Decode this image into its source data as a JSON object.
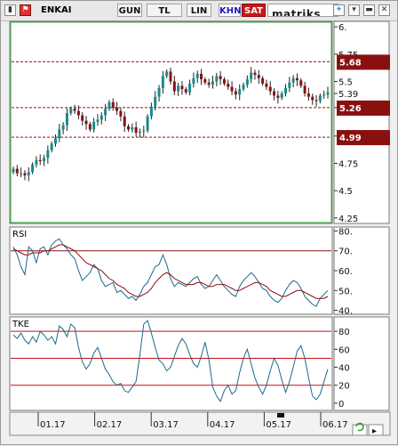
{
  "toolbar": {
    "symbol": "ENKAI",
    "buttons": [
      "GUN",
      "TL",
      "LIN",
      "KHN",
      "SAT"
    ],
    "brand": "matriks",
    "icons": [
      "bar-chart-icon",
      "flag-icon",
      "twitter-icon",
      "dropdown-icon",
      "minimize-icon",
      "close-icon"
    ]
  },
  "colors": {
    "up_candle": "#1a8a8a",
    "down_candle": "#8a1010",
    "wick": "#222222",
    "level_line": "#8a1010",
    "price_pill": "#8a1010",
    "rsi_line": "#1a6a8a",
    "rsi_signal": "#8a1010",
    "tke_line": "#1a6a8a",
    "hline": "#c81010",
    "panel_bg": "#ffffff"
  },
  "chart_data": [
    {
      "type": "candlestick",
      "title": "ENKAI",
      "ylim": [
        4.2,
        6.05
      ],
      "yticks": [
        "6.",
        "5.75",
        "5.5",
        "5.39",
        "5.26",
        "5",
        "4.75",
        "4.5",
        "4.25"
      ],
      "ytick_values": [
        6.0,
        5.75,
        5.5,
        5.39,
        5.26,
        5.0,
        4.75,
        4.5,
        4.25
      ],
      "levels": [
        {
          "label": "5.68",
          "value": 5.68
        },
        {
          "label": "5.26",
          "value": 5.26
        },
        {
          "label": "4.99",
          "value": 4.99
        }
      ],
      "x_labels": [
        "01.17",
        "02.17",
        "03.17",
        "04.17",
        "05.17",
        "06.17"
      ],
      "closes": [
        4.7,
        4.66,
        4.66,
        4.64,
        4.67,
        4.74,
        4.78,
        4.77,
        4.8,
        4.87,
        4.93,
        4.98,
        5.06,
        5.1,
        5.21,
        5.25,
        5.23,
        5.19,
        5.14,
        5.11,
        5.06,
        5.13,
        5.15,
        5.19,
        5.25,
        5.31,
        5.26,
        5.23,
        5.18,
        5.09,
        5.06,
        5.08,
        5.03,
        5.04,
        5.05,
        5.18,
        5.27,
        5.36,
        5.44,
        5.55,
        5.59,
        5.5,
        5.41,
        5.46,
        5.43,
        5.4,
        5.48,
        5.53,
        5.57,
        5.52,
        5.49,
        5.47,
        5.5,
        5.55,
        5.52,
        5.48,
        5.45,
        5.41,
        5.38,
        5.43,
        5.47,
        5.52,
        5.58,
        5.56,
        5.53,
        5.48,
        5.45,
        5.41,
        5.37,
        5.35,
        5.39,
        5.44,
        5.49,
        5.53,
        5.51,
        5.46,
        5.39,
        5.36,
        5.33,
        5.32,
        5.37,
        5.38,
        5.4
      ]
    },
    {
      "type": "line",
      "title": "RSI",
      "ylim": [
        38,
        82
      ],
      "yticks": [
        "80.",
        "70.",
        "60.",
        "50.",
        "40."
      ],
      "ytick_values": [
        80,
        70,
        60,
        50,
        40
      ],
      "hlines": [
        70
      ],
      "series": [
        {
          "role": "rsi",
          "values": [
            72,
            68,
            62,
            58,
            72,
            70,
            64,
            71,
            72,
            68,
            73,
            75,
            76,
            73,
            71,
            68,
            66,
            60,
            55,
            57,
            59,
            63,
            61,
            55,
            52,
            53,
            54,
            49,
            50,
            48,
            46,
            47,
            45,
            48,
            52,
            54,
            58,
            62,
            63,
            68,
            63,
            56,
            52,
            54,
            53,
            52,
            54,
            56,
            57,
            53,
            51,
            52,
            55,
            58,
            55,
            52,
            50,
            48,
            47,
            52,
            55,
            57,
            59,
            57,
            54,
            51,
            50,
            47,
            45,
            44,
            46,
            50,
            53,
            55,
            54,
            51,
            47,
            45,
            43,
            42,
            46,
            48,
            50
          ]
        },
        {
          "role": "signal",
          "values": [
            71,
            70,
            69,
            68,
            68,
            69,
            69,
            69,
            70,
            70,
            71,
            72,
            73,
            73,
            72,
            71,
            70,
            68,
            66,
            64,
            63,
            62,
            61,
            60,
            58,
            56,
            55,
            53,
            52,
            51,
            49,
            48,
            47,
            47,
            48,
            49,
            51,
            54,
            56,
            58,
            59,
            58,
            56,
            55,
            54,
            53,
            53,
            53,
            54,
            54,
            53,
            52,
            52,
            53,
            53,
            53,
            52,
            51,
            50,
            50,
            51,
            52,
            53,
            54,
            54,
            53,
            52,
            50,
            49,
            48,
            47,
            47,
            48,
            49,
            50,
            50,
            49,
            48,
            47,
            46,
            46,
            46,
            47
          ]
        }
      ]
    },
    {
      "type": "line",
      "title": "TKE",
      "ylim": [
        -8,
        96
      ],
      "yticks": [
        "80",
        "60",
        "40",
        "20",
        "0"
      ],
      "ytick_values": [
        80,
        60,
        40,
        20,
        0
      ],
      "hlines": [
        80,
        50,
        20
      ],
      "series": [
        {
          "role": "tke",
          "values": [
            76,
            72,
            78,
            70,
            66,
            74,
            68,
            80,
            76,
            70,
            74,
            66,
            86,
            82,
            74,
            88,
            84,
            62,
            46,
            38,
            44,
            56,
            62,
            50,
            38,
            32,
            24,
            20,
            22,
            14,
            12,
            18,
            24,
            54,
            88,
            92,
            78,
            62,
            48,
            44,
            36,
            40,
            52,
            64,
            72,
            66,
            54,
            44,
            40,
            52,
            68,
            48,
            18,
            8,
            2,
            14,
            20,
            10,
            14,
            34,
            50,
            60,
            44,
            28,
            18,
            10,
            20,
            36,
            50,
            42,
            26,
            12,
            24,
            40,
            58,
            64,
            50,
            28,
            8,
            4,
            10,
            24,
            38
          ]
        }
      ]
    }
  ]
}
